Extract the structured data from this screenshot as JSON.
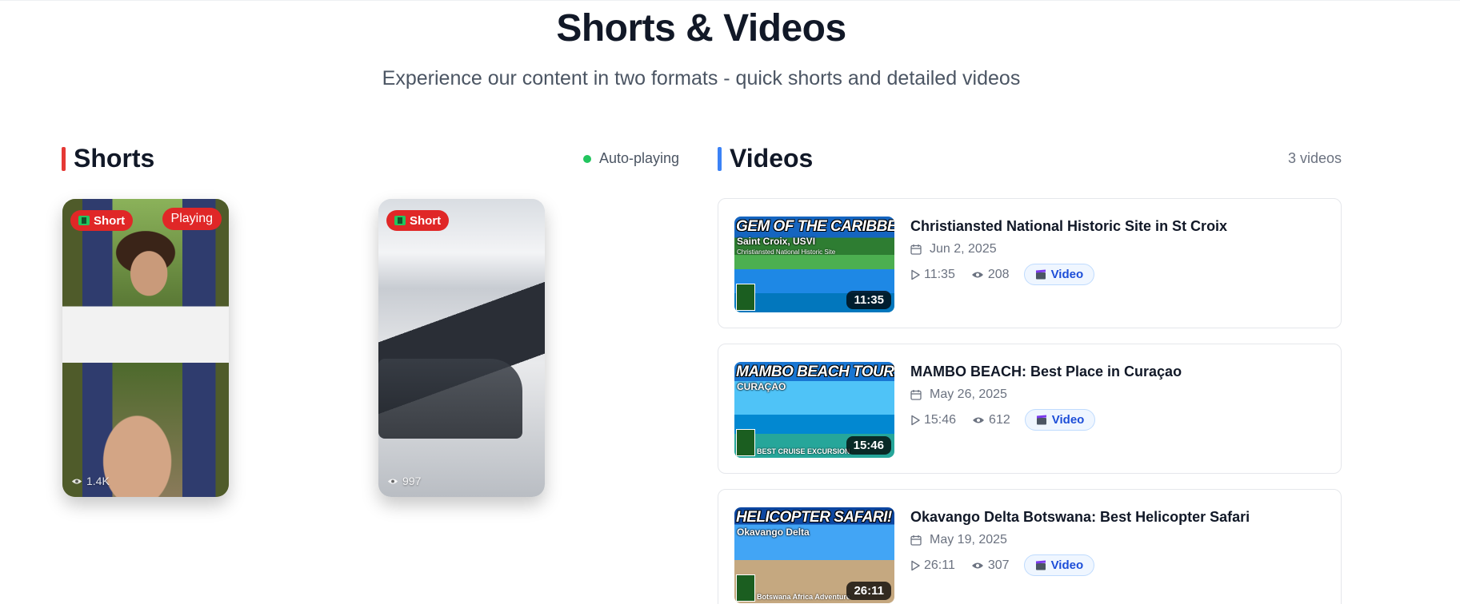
{
  "header": {
    "title": "Shorts & Videos",
    "subtitle": "Experience our content in two formats - quick shorts and detailed videos"
  },
  "shorts": {
    "title": "Shorts",
    "status": "Auto-playing",
    "accent_color": "#e53935",
    "items": [
      {
        "badge": "Short",
        "state": "Playing",
        "views": "1.4K"
      },
      {
        "badge": "Short",
        "views": "997"
      }
    ]
  },
  "videos": {
    "title": "Videos",
    "count": "3 videos",
    "accent_color": "#3b82f6",
    "items": [
      {
        "title": "Christiansted National Historic Site in St Croix",
        "date": "Jun 2, 2025",
        "duration": "11:35",
        "views": "208",
        "type": "Video",
        "thumb_headline": "GEM OF THE CARIBBEAN!",
        "thumb_subheadline": "Saint Croix, USVI",
        "thumb_caption": "Christiansted National Historic Site",
        "thumb_footer": ""
      },
      {
        "title": "MAMBO BEACH: Best Place in Curaçao",
        "date": "May 26, 2025",
        "duration": "15:46",
        "views": "612",
        "type": "Video",
        "thumb_headline": "MAMBO BEACH TOUR!",
        "thumb_subheadline": "CURAÇAO",
        "thumb_caption": "",
        "thumb_footer": "BEST CRUISE EXCURSION"
      },
      {
        "title": "Okavango Delta Botswana: Best Helicopter Safari",
        "date": "May 19, 2025",
        "duration": "26:11",
        "views": "307",
        "type": "Video",
        "thumb_headline": "HELICOPTER SAFARI!",
        "thumb_subheadline": "Okavango Delta",
        "thumb_caption": "",
        "thumb_footer": "Botswana Africa Adventure"
      }
    ]
  },
  "icons": {
    "status_dot": "green-dot",
    "short_badge": "film-icon",
    "views": "eye-icon",
    "date": "calendar-icon",
    "duration": "play-icon",
    "type": "clapper-icon"
  },
  "colors": {
    "short_badge": "#e02727",
    "live_dot": "#22c55e",
    "video_tag": "#1d4ed8"
  }
}
